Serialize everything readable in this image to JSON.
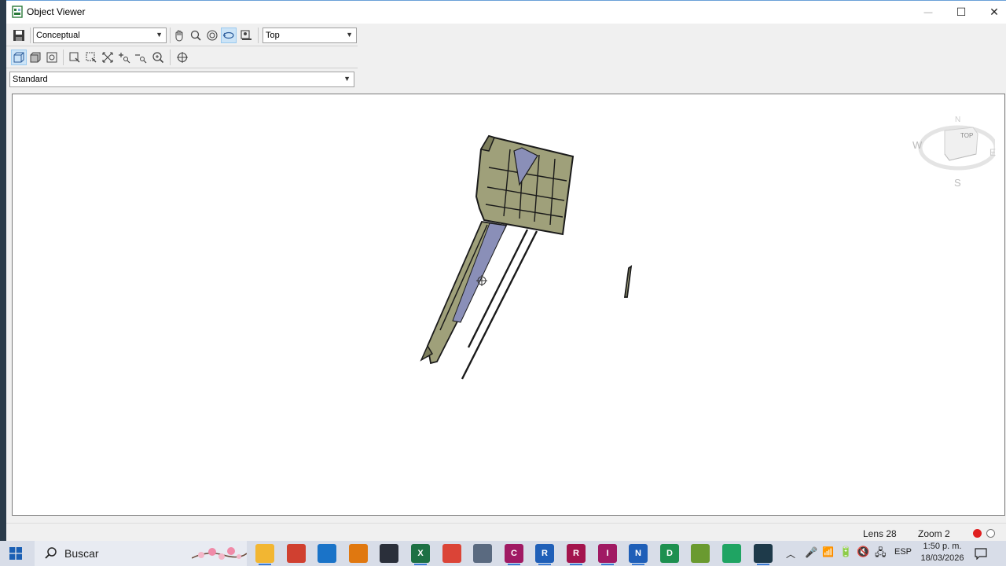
{
  "window": {
    "title": "Object Viewer",
    "controls": {
      "minimize": "—",
      "maximize": "☐",
      "close": "✕"
    }
  },
  "toolbar": {
    "visual_style": "Conceptual",
    "view": "Top",
    "standard": "Standard",
    "row1_icons": [
      "save-icon",
      "pan-icon",
      "zoom-icon",
      "orbit-icon",
      "constrained-orbit-icon",
      "camera-icon"
    ],
    "row2_icons": [
      "wireframe-icon",
      "shaded-icon",
      "perspective-icon",
      "zoom-window-icon",
      "zoom-extents-icon",
      "zoom-all-icon",
      "zoom-in-icon",
      "zoom-out-icon",
      "zoom-realtime-icon",
      "target-icon"
    ]
  },
  "viewcube": {
    "face": "TOP",
    "north": "N",
    "south": "S",
    "east": "E",
    "west": "W"
  },
  "status": {
    "lens": "Lens 28",
    "zoom": "Zoom 2"
  },
  "taskbar": {
    "search_label": "Buscar",
    "apps": [
      {
        "name": "file-explorer",
        "label": "",
        "color": "#f2b632"
      },
      {
        "name": "app-red",
        "label": "",
        "color": "#d04030"
      },
      {
        "name": "outlook",
        "label": "",
        "color": "#1a73c8"
      },
      {
        "name": "search-tool",
        "label": "",
        "color": "#e07810"
      },
      {
        "name": "app-dark",
        "label": "",
        "color": "#2a2f3a"
      },
      {
        "name": "excel",
        "label": "X",
        "color": "#1d7044"
      },
      {
        "name": "chrome",
        "label": "",
        "color": "#db4437"
      },
      {
        "name": "app-recycle",
        "label": "",
        "color": "#5a6a80"
      },
      {
        "name": "civil3d",
        "label": "C",
        "color": "#a01a64"
      },
      {
        "name": "revit",
        "label": "R",
        "color": "#1f5fb8"
      },
      {
        "name": "recap",
        "label": "R",
        "color": "#a3144e"
      },
      {
        "name": "infraworks",
        "label": "I",
        "color": "#a01a64"
      },
      {
        "name": "navisworks",
        "label": "N",
        "color": "#1f5fb8"
      },
      {
        "name": "app-green",
        "label": "D",
        "color": "#1d9050"
      },
      {
        "name": "app-plant",
        "label": "",
        "color": "#6a9a30"
      },
      {
        "name": "drive",
        "label": "",
        "color": "#1fa463"
      },
      {
        "name": "terminal",
        "label": "",
        "color": "#1e3a4a"
      }
    ],
    "language": "ESP",
    "time": "1:50 p. m.",
    "date": "18/03/2026"
  }
}
